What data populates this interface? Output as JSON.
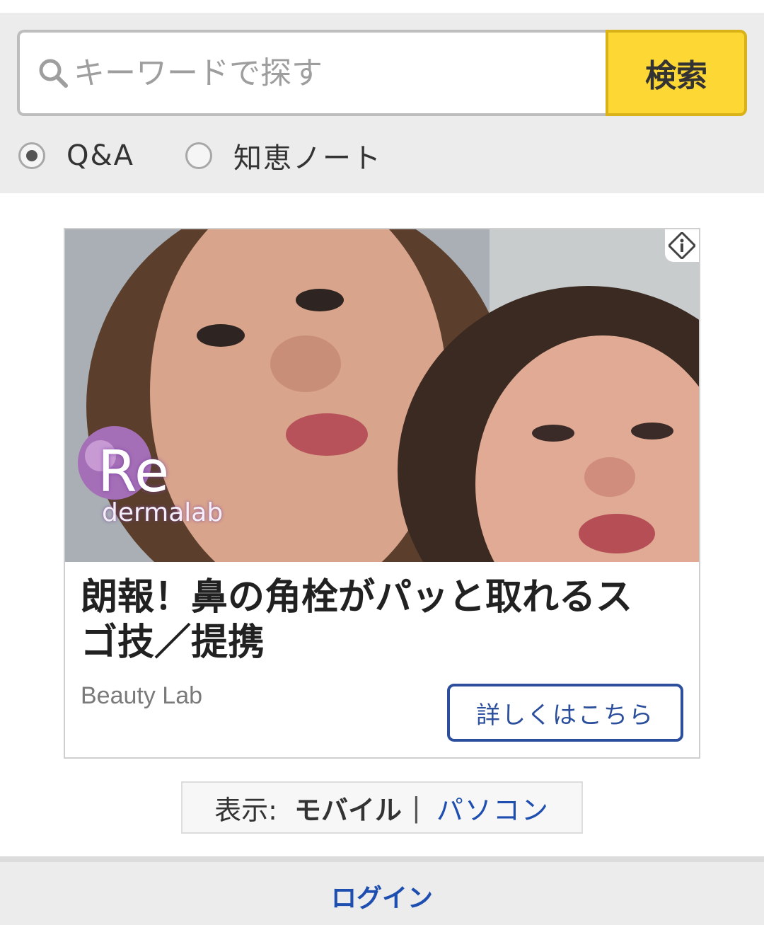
{
  "search": {
    "placeholder": "キーワードで探す",
    "button_label": "検索",
    "options": [
      {
        "label": "Q&A",
        "selected": true
      },
      {
        "label": "知恵ノート",
        "selected": false
      }
    ]
  },
  "ad": {
    "logo_text": "Re",
    "logo_subtext": "dermalab",
    "headline": "朗報！鼻の角栓がパッと取れるスゴ技／提携",
    "source": "Beauty Lab",
    "cta_label": "詳しくはこちら",
    "info_icon": "ad-info-icon"
  },
  "view_switch": {
    "prefix": "表示:",
    "current": "モバイル",
    "separator": "|",
    "alternative": "パソコン"
  },
  "footer": {
    "login_label": "ログイン"
  },
  "colors": {
    "search_button_bg": "#fdd835",
    "link_blue": "#1e4fb0",
    "cta_border": "#2b4f9c"
  }
}
